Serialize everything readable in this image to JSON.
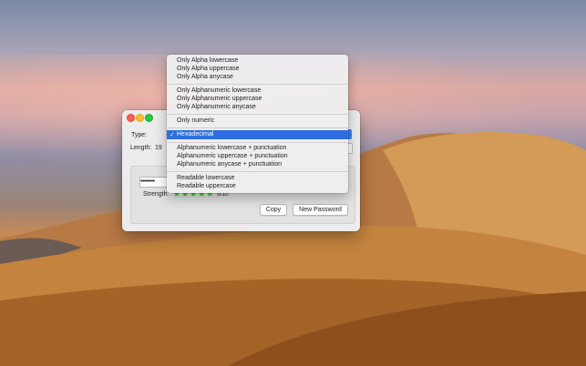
{
  "window": {
    "type_label": "Type:",
    "length_label": "Length:",
    "length_value": "19",
    "password_masked": "••••••••",
    "strength_label": "Strength:",
    "strength_stars": "★★★★★",
    "strength_value": "5/10",
    "copy_button": "Copy",
    "new_password_button": "New Password"
  },
  "menu": {
    "items": [
      "Only Alpha lowercase",
      "Only Alpha uppercase",
      "Only Alpha anycase",
      "Only Alphanumeric lowercase",
      "Only Alphanumeric uppercase",
      "Only Alphanumeric anycase",
      "Only numeric",
      "Hexadecimal",
      "Alphanumeric lowercase + punctuation",
      "Alphanumeric uppercase + punctuation",
      "Alphanumeric anycase + punctuation",
      "Readable lowercase",
      "Readable uppercase"
    ],
    "selected_check": "✓",
    "selected_index": 7
  },
  "colors": {
    "selection": "#2d6fe0",
    "stars": "#3fbf3a",
    "close": "#fd5f57",
    "minimize": "#febc2e",
    "maximize": "#28c840"
  }
}
